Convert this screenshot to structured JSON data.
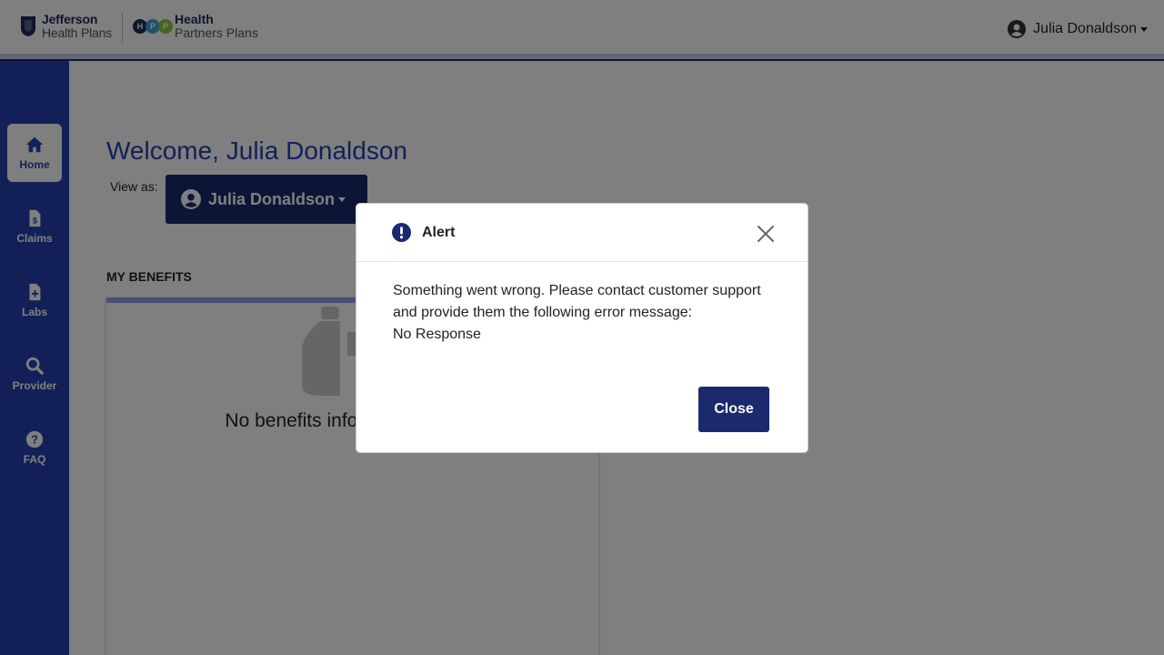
{
  "header": {
    "brand1_line1": "Jefferson",
    "brand1_line2": "Health Plans",
    "brand2_line1": "Health",
    "brand2_line2": "Partners Plans",
    "hpp_letters": [
      "H",
      "P",
      "P"
    ],
    "user_name": "Julia Donaldson"
  },
  "sidebar": {
    "items": [
      {
        "label": "Home",
        "icon": "home-icon"
      },
      {
        "label": "Claims",
        "icon": "claims-icon"
      },
      {
        "label": "Labs",
        "icon": "labs-icon"
      },
      {
        "label": "Provider",
        "icon": "search-icon"
      },
      {
        "label": "FAQ",
        "icon": "question-icon"
      }
    ],
    "active": "Home"
  },
  "main": {
    "welcome": "Welcome, Julia Donaldson",
    "view_as_label": "View as:",
    "view_as_user": "Julia Donaldson",
    "benefits_title": "MY BENEFITS",
    "no_benefits_text": "No benefits information found."
  },
  "modal": {
    "title": "Alert",
    "message_line1": "Something went wrong. Please contact customer support and provide them the following error message:",
    "error_message": "No Response",
    "close_label": "Close"
  },
  "colors": {
    "brand_blue": "#2740b0",
    "navy": "#1a2a6c",
    "accent_light": "#8ea2e8",
    "overlay": "rgba(0,0,0,0.5)"
  }
}
